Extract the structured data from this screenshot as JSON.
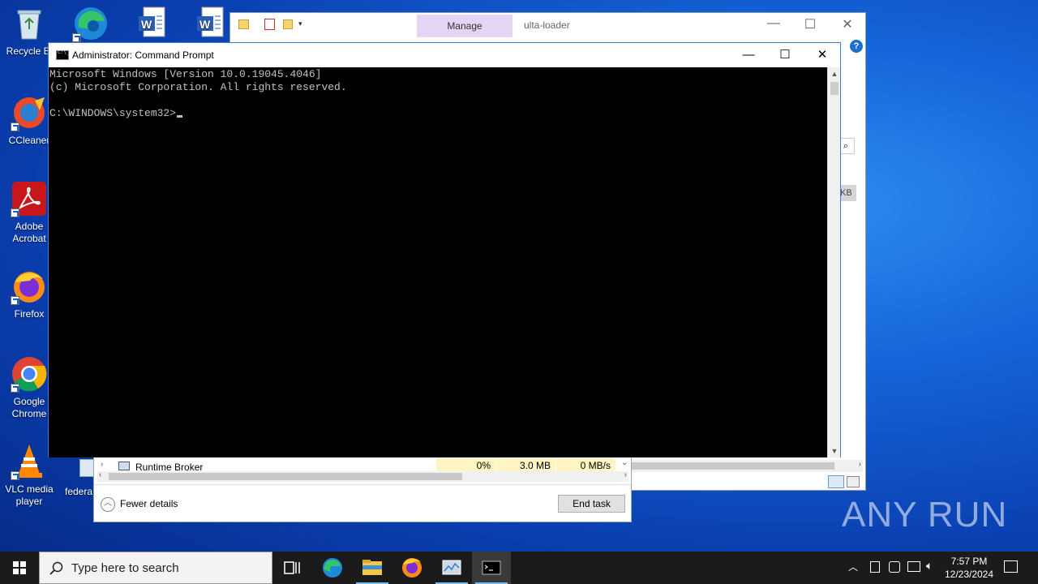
{
  "desktop": {
    "icons": [
      {
        "label": "Recycle Bin",
        "icon": "recycle-bin-icon"
      },
      {
        "label": "CCleaner",
        "icon": "ccleaner-icon"
      },
      {
        "label": "Adobe Acrobat",
        "icon": "adobe-acrobat-icon"
      },
      {
        "label": "Firefox",
        "icon": "firefox-icon"
      },
      {
        "label": "Google Chrome",
        "icon": "chrome-icon"
      },
      {
        "label": "VLC media player",
        "icon": "vlc-icon"
      },
      {
        "label": "federa",
        "icon": "file-icon"
      }
    ],
    "recycle_label": "Recycle Bi",
    "ccleaner_label": "CCleaner",
    "adobe_label_1": "Adobe",
    "adobe_label_2": "Acrobat",
    "firefox_label": "Firefox",
    "chrome_label_1": "Google",
    "chrome_label_2": "Chrome",
    "vlc_label_1": "VLC media",
    "vlc_label_2": "player",
    "federa_label": "federa"
  },
  "explorer": {
    "manage_tab": "Manage",
    "title": "ulta-loader",
    "size_fragment": "KB"
  },
  "taskmgr": {
    "process_name": "Runtime Broker",
    "cpu": "0%",
    "memory": "3.0 MB",
    "disk": "0 MB/s",
    "fewer_details": "Fewer details",
    "end_task": "End task"
  },
  "cmd": {
    "title": "Administrator: Command Prompt",
    "line1": "Microsoft Windows [Version 10.0.19045.4046]",
    "line2": "(c) Microsoft Corporation. All rights reserved.",
    "prompt": "C:\\WINDOWS\\system32>"
  },
  "taskbar": {
    "search_placeholder": "Type here to search",
    "time": "7:57 PM",
    "date": "12/23/2024"
  },
  "watermark": "ANY RUN"
}
